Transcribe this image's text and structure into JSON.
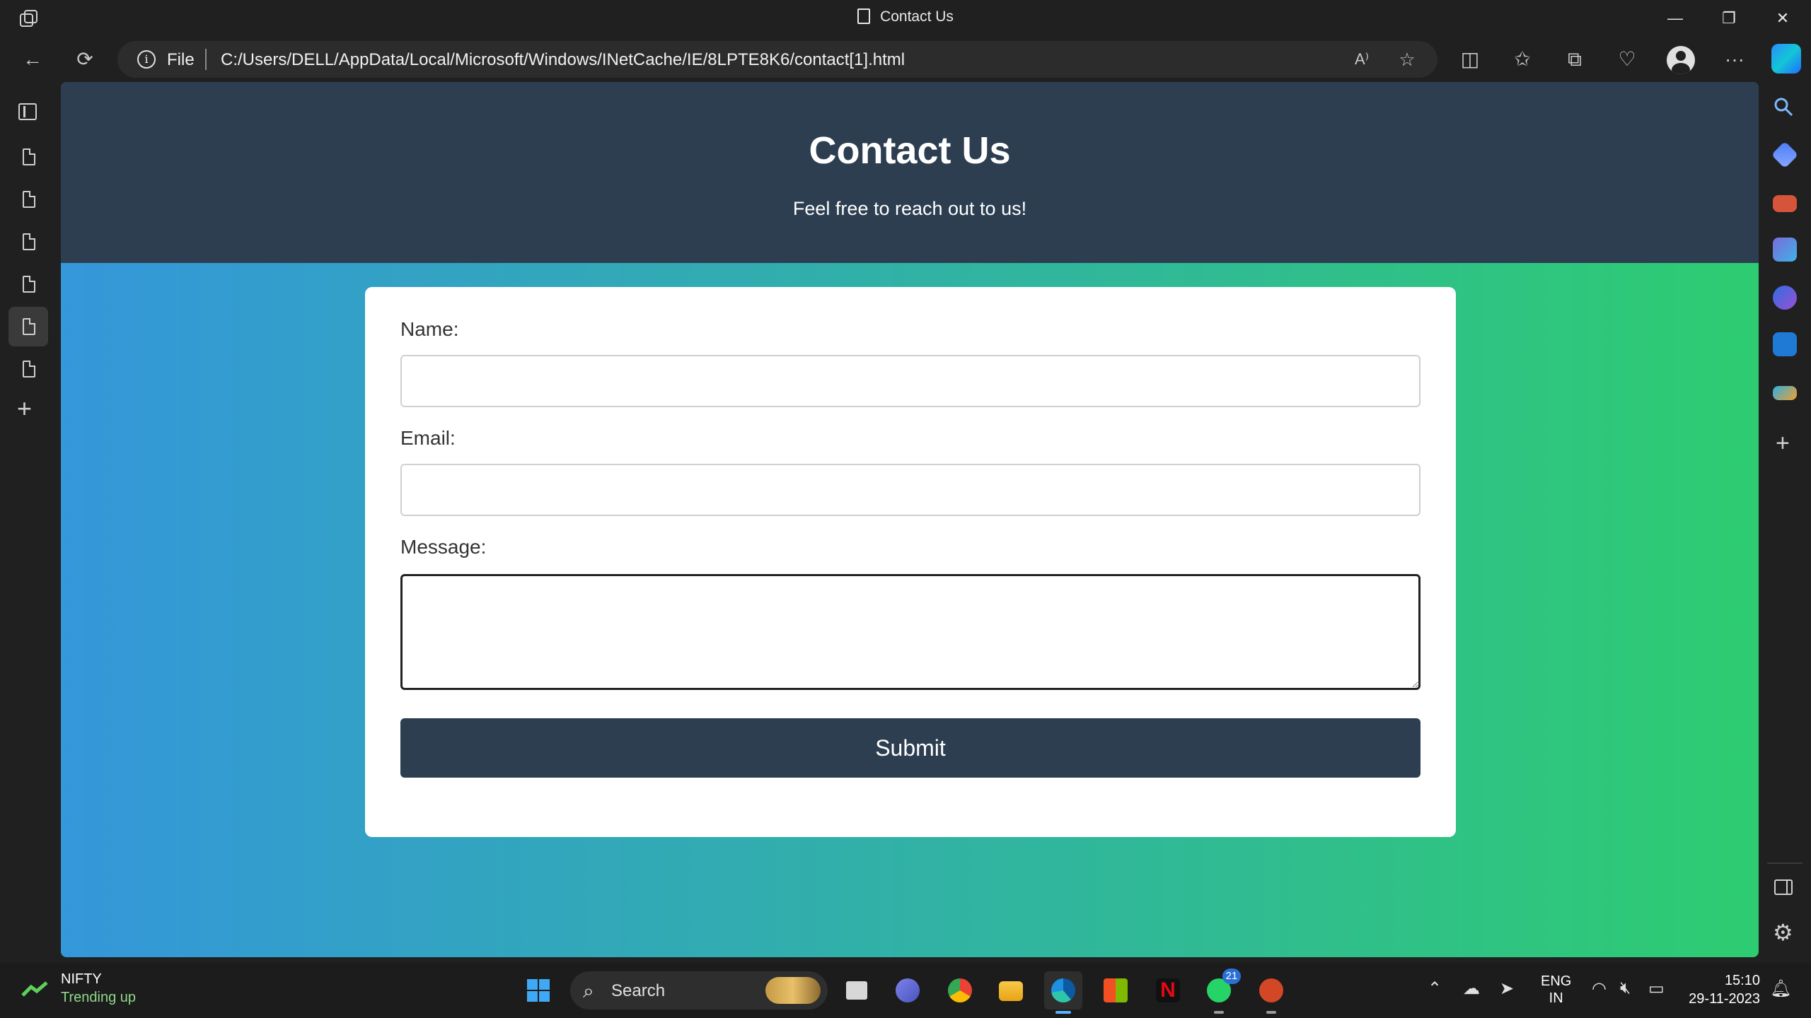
{
  "window": {
    "title": "Contact Us",
    "controls": {
      "minimize": "—",
      "restore": "❐",
      "close": "✕"
    }
  },
  "toolbar": {
    "scheme": "File",
    "url": "C:/Users/DELL/AppData/Local/Microsoft/Windows/INetCache/IE/8LPTE8K6/contact[1].html",
    "icons": [
      "back-icon",
      "refresh-icon",
      "read-aloud-icon",
      "favorite-icon",
      "split-screen-icon",
      "favorites-icon",
      "collections-icon",
      "performance-icon",
      "profile-icon",
      "more-icon",
      "copilot-icon"
    ]
  },
  "sidebar": {
    "vertical_tabs": 6,
    "active_tab": 5
  },
  "page": {
    "heading": "Contact Us",
    "subheading": "Feel free to reach out to us!",
    "form": {
      "name_label": "Name:",
      "email_label": "Email:",
      "message_label": "Message:",
      "name_value": "",
      "email_value": "",
      "message_value": "",
      "submit_label": "Submit"
    }
  },
  "taskbar": {
    "widget": {
      "title": "NIFTY",
      "subtitle": "Trending up"
    },
    "search_label": "Search",
    "whatsapp_badge": "21",
    "lang": {
      "line1": "ENG",
      "line2": "IN"
    },
    "time": "15:10",
    "date": "29-11-2023"
  },
  "colors": {
    "header_bg": "#2c3e50",
    "gradient_start": "#3497da",
    "gradient_end": "#2ecc71",
    "submit_bg": "#2c3e50"
  }
}
